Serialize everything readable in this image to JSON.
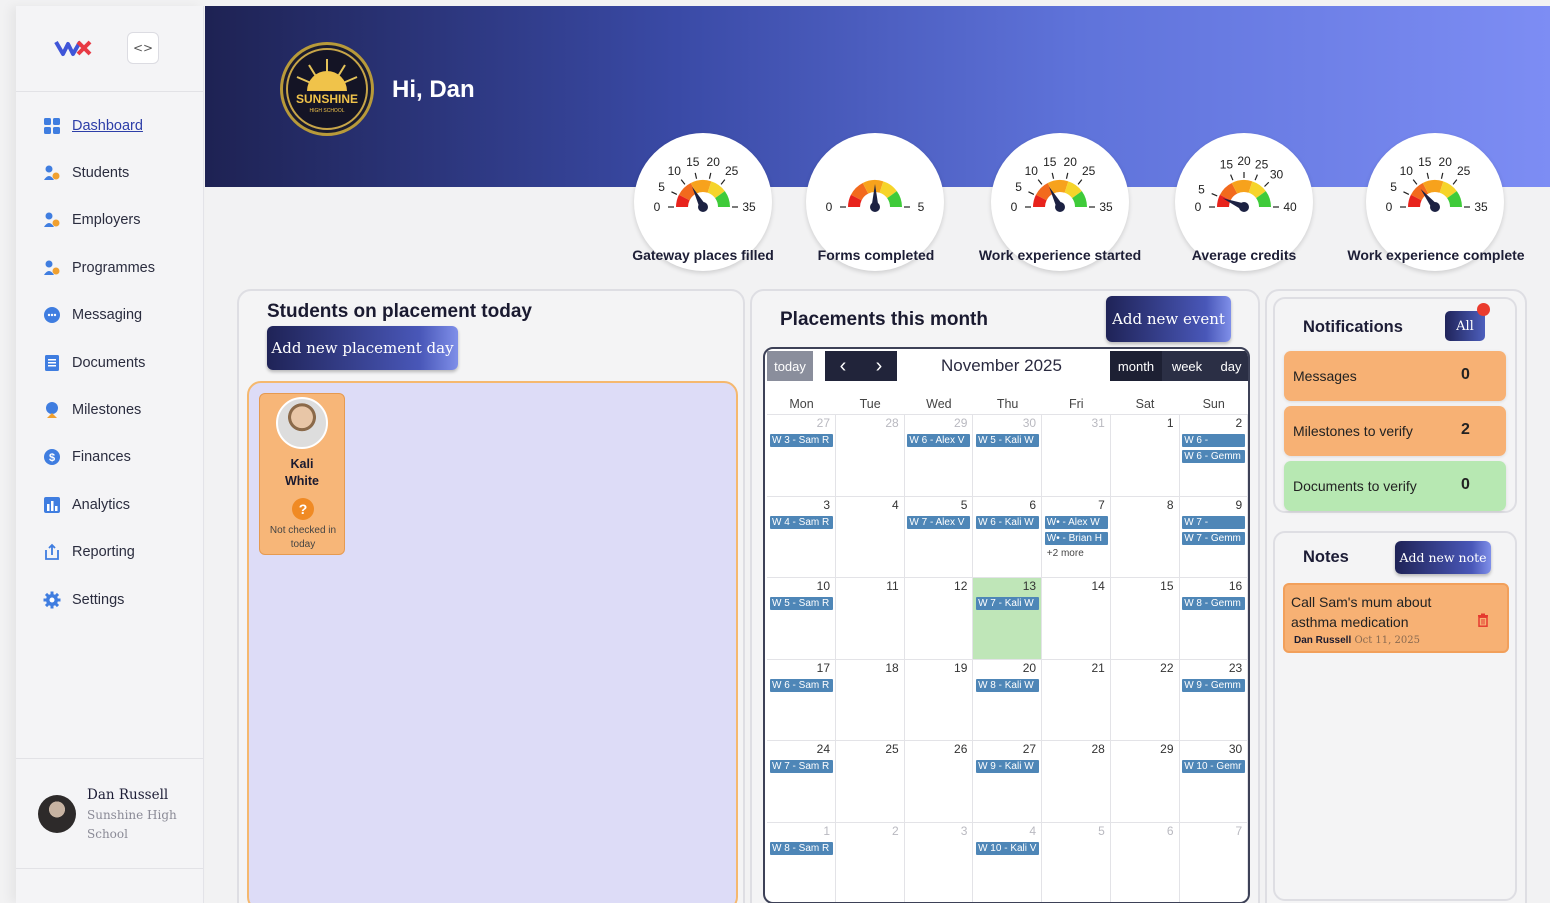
{
  "sidebar": {
    "items": [
      {
        "label": "Dashboard",
        "icon": "dashboard-icon"
      },
      {
        "label": "Students",
        "icon": "students-icon"
      },
      {
        "label": "Employers",
        "icon": "employers-icon"
      },
      {
        "label": "Programmes",
        "icon": "programmes-icon"
      },
      {
        "label": "Messaging",
        "icon": "messaging-icon"
      },
      {
        "label": "Documents",
        "icon": "documents-icon"
      },
      {
        "label": "Milestones",
        "icon": "milestones-icon"
      },
      {
        "label": "Finances",
        "icon": "finances-icon"
      },
      {
        "label": "Analytics",
        "icon": "analytics-icon"
      },
      {
        "label": "Reporting",
        "icon": "reporting-icon"
      },
      {
        "label": "Settings",
        "icon": "settings-icon"
      }
    ],
    "collapse_label": "<>",
    "user": {
      "name": "Dan Russell",
      "school": "Sunshine High School"
    }
  },
  "header": {
    "greeting": "Hi, Dan",
    "school_logo_text": "SUNSHINE",
    "school_logo_subtext": "HIGH SCHOOL"
  },
  "gauges": [
    {
      "label": "Gateway places filled",
      "ticks": [
        "0",
        "5",
        "10",
        "15",
        "20",
        "25",
        "35"
      ],
      "max": 35,
      "value": 12
    },
    {
      "label": "Forms completed",
      "ticks": [
        "0",
        "5"
      ],
      "max": 5,
      "value": 2.5
    },
    {
      "label": "Work experience started",
      "ticks": [
        "0",
        "5",
        "10",
        "15",
        "20",
        "25",
        "35"
      ],
      "max": 35,
      "value": 12
    },
    {
      "label": "Average credits",
      "ticks": [
        "0",
        "5",
        "15",
        "20",
        "25",
        "30",
        "40"
      ],
      "max": 40,
      "value": 5
    },
    {
      "label": "Work experience complete",
      "ticks": [
        "0",
        "5",
        "10",
        "15",
        "20",
        "25",
        "35"
      ],
      "max": 35,
      "value": 10
    }
  ],
  "students_panel": {
    "title": "Students on placement today",
    "add_button": "Add new placement day",
    "students": [
      {
        "first_name": "Kali",
        "last_name": "White",
        "status": "Not checked in today",
        "status_icon": "?"
      }
    ]
  },
  "calendar_panel": {
    "title": "Placements this month",
    "add_button": "Add new event",
    "today_label": "today",
    "prev_icon": "‹",
    "next_icon": "›",
    "month_title": "November 2025",
    "views": [
      "month",
      "week",
      "day"
    ],
    "weekdays": [
      "Mon",
      "Tue",
      "Wed",
      "Thu",
      "Fri",
      "Sat",
      "Sun"
    ],
    "weeks": [
      [
        {
          "d": "27",
          "m": true,
          "ev": [
            "W 3 - Sam R"
          ]
        },
        {
          "d": "28",
          "m": true,
          "ev": []
        },
        {
          "d": "29",
          "m": true,
          "ev": [
            "W 6 - Alex V"
          ]
        },
        {
          "d": "30",
          "m": true,
          "ev": [
            "W 5 - Kali W"
          ]
        },
        {
          "d": "31",
          "m": true,
          "ev": []
        },
        {
          "d": "1",
          "ev": []
        },
        {
          "d": "2",
          "ev": [
            "W 6 -",
            "W 6 - Gemm"
          ]
        }
      ],
      [
        {
          "d": "3",
          "ev": [
            "W 4 - Sam R"
          ]
        },
        {
          "d": "4",
          "ev": []
        },
        {
          "d": "5",
          "ev": [
            "W 7 - Alex V"
          ]
        },
        {
          "d": "6",
          "ev": [
            "W 6 - Kali W"
          ]
        },
        {
          "d": "7",
          "ev": [
            "W• - Alex W",
            "W• - Brian H"
          ],
          "more": "+2 more"
        },
        {
          "d": "8",
          "ev": []
        },
        {
          "d": "9",
          "ev": [
            "W 7 -",
            "W 7 - Gemm"
          ]
        }
      ],
      [
        {
          "d": "10",
          "ev": [
            "W 5 - Sam R"
          ]
        },
        {
          "d": "11",
          "ev": []
        },
        {
          "d": "12",
          "ev": []
        },
        {
          "d": "13",
          "today": true,
          "ev": [
            "W 7 - Kali W"
          ]
        },
        {
          "d": "14",
          "ev": []
        },
        {
          "d": "15",
          "ev": []
        },
        {
          "d": "16",
          "ev": [
            "W 8 - Gemm"
          ]
        }
      ],
      [
        {
          "d": "17",
          "ev": [
            "W 6 - Sam R"
          ]
        },
        {
          "d": "18",
          "ev": []
        },
        {
          "d": "19",
          "ev": []
        },
        {
          "d": "20",
          "ev": [
            "W 8 - Kali W"
          ]
        },
        {
          "d": "21",
          "ev": []
        },
        {
          "d": "22",
          "ev": []
        },
        {
          "d": "23",
          "ev": [
            "W 9 - Gemm"
          ]
        }
      ],
      [
        {
          "d": "24",
          "ev": [
            "W 7 - Sam R"
          ]
        },
        {
          "d": "25",
          "ev": []
        },
        {
          "d": "26",
          "ev": []
        },
        {
          "d": "27",
          "ev": [
            "W 9 - Kali W"
          ]
        },
        {
          "d": "28",
          "ev": []
        },
        {
          "d": "29",
          "ev": []
        },
        {
          "d": "30",
          "ev": [
            "W 10 - Gemr"
          ]
        }
      ],
      [
        {
          "d": "1",
          "m": true,
          "ev": [
            "W 8 - Sam R"
          ]
        },
        {
          "d": "2",
          "m": true,
          "ev": []
        },
        {
          "d": "3",
          "m": true,
          "ev": []
        },
        {
          "d": "4",
          "m": true,
          "ev": [
            "W 10 - Kali V"
          ]
        },
        {
          "d": "5",
          "m": true,
          "ev": []
        },
        {
          "d": "6",
          "m": true,
          "ev": []
        },
        {
          "d": "7",
          "m": true,
          "ev": []
        }
      ]
    ]
  },
  "notifications": {
    "title": "Notifications",
    "all_button": "All",
    "items": [
      {
        "label": "Messages",
        "count": "0",
        "color": "#f7b174"
      },
      {
        "label": "Milestones to verify",
        "count": "2",
        "color": "#f7b174"
      },
      {
        "label": "Documents to verify",
        "count": "0",
        "color": "#b7e8b2"
      }
    ]
  },
  "notes": {
    "title": "Notes",
    "add_button": "Add new note",
    "items": [
      {
        "text": "Call Sam's mum about asthma medication",
        "author": "Dan Russell",
        "date": "Oct 11, 2025"
      }
    ]
  },
  "colors": {
    "accent": "#2d3ea8",
    "event": "#4e86b7",
    "today": "#bfe6b8",
    "orange": "#f7b174"
  }
}
